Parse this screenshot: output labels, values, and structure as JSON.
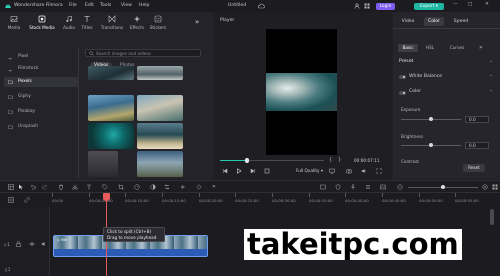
{
  "app": {
    "name": "Wondershare Filmora",
    "menu": [
      "File",
      "Edit",
      "Tools",
      "View",
      "Help"
    ],
    "project_title": "Untitled",
    "login_label": "Login",
    "export_label": "Export"
  },
  "media_tabs": [
    {
      "label": "Media",
      "icon": "media-icon"
    },
    {
      "label": "Stock Media",
      "icon": "stock-media-icon"
    },
    {
      "label": "Audio",
      "icon": "audio-icon"
    },
    {
      "label": "Titles",
      "icon": "titles-icon"
    },
    {
      "label": "Transitions",
      "icon": "transitions-icon"
    },
    {
      "label": "Effects",
      "icon": "effects-icon"
    },
    {
      "label": "Stickers",
      "icon": "stickers-icon"
    }
  ],
  "side_nav": {
    "items": [
      {
        "label": "Pixel",
        "lead": "→"
      },
      {
        "label": "Filmstock",
        "lead": "→"
      },
      {
        "label": "Pexels",
        "lead": ""
      },
      {
        "label": "Giphy",
        "lead": ""
      },
      {
        "label": "Pixabay",
        "lead": ""
      },
      {
        "label": "Unsplash",
        "lead": ""
      }
    ],
    "active_index": 2
  },
  "search": {
    "placeholder": "Search images and videos"
  },
  "segments": {
    "videos": "Videos",
    "photos": "Photos"
  },
  "player": {
    "label": "Player",
    "time": "00:00:07:11",
    "quality": "Full Quality",
    "progress": 0.26
  },
  "properties": {
    "tabs": [
      "Video",
      "Color",
      "Speed"
    ],
    "active_tab": 1,
    "subtabs": [
      "Basic",
      "HSL",
      "Curves"
    ],
    "section": "Preset",
    "white_balance": "White Balance",
    "color": "Color",
    "exposure": {
      "label": "Exposure",
      "value": "0.0",
      "level": 0.5
    },
    "brightness": {
      "label": "Brightness",
      "value": "0.0",
      "level": 0.5
    },
    "contrast": {
      "label": "Contrast"
    },
    "reset_label": "Reset"
  },
  "timeline": {
    "ticks": [
      "00:00",
      "00:00:05:00",
      "00:00:10:00",
      "00:00:15:00",
      "00:00:20:00",
      "00:00:25:00",
      "00:00:30:00",
      "00:00:35:00",
      "00:00:40:00",
      "00:00:45:00",
      "00:00:50:00",
      "00:00:55:00"
    ],
    "tooltip": [
      "Click to split (Ctrl+B)",
      "Drag to move playhead"
    ],
    "clip_name": "file"
  },
  "watermark": "takeitpc.com",
  "colors": {
    "accent": "#27c7b0",
    "export": "#20b7a2",
    "login": "#7d5cf0",
    "playhead": "#e85b5b",
    "clip": "#3a6fd1"
  }
}
